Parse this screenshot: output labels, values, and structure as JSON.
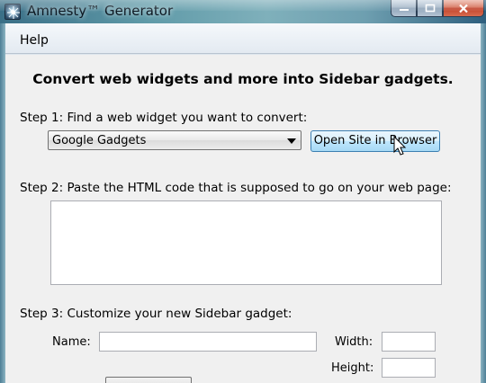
{
  "window": {
    "title": "Amnesty™ Generator"
  },
  "menu": {
    "help": "Help"
  },
  "main": {
    "heading": "Convert web widgets and more into Sidebar gadgets.",
    "step1_label": "Step 1: Find a web widget you want to convert:",
    "widget_source_selected": "Google Gadgets",
    "open_site_button": "Open Site in Browser",
    "step2_label": "Step 2: Paste the HTML code that is supposed to go on your web page:",
    "html_code_value": "",
    "step3_label": "Step 3: Customize your new Sidebar gadget:",
    "name_label": "Name:",
    "name_value": "",
    "width_label": "Width:",
    "width_value": "",
    "height_label": "Height:",
    "height_value": ""
  }
}
